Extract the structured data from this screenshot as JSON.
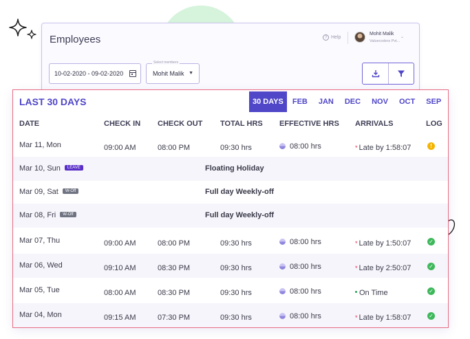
{
  "header": {
    "title": "Employees",
    "help_label": "Help",
    "user_name": "Mohit Malik",
    "user_org": "Valuecoders Pvt...",
    "date_range": "10-02-2020 - 09-02-2020",
    "select_members_legend": "Select members",
    "selected_member": "Mohit Malik"
  },
  "attendance": {
    "title": "LAST 30 DAYS",
    "periods": [
      "30 DAYS",
      "FEB",
      "JAN",
      "DEC",
      "NOV",
      "OCT",
      "SEP"
    ],
    "active_period": "30 DAYS",
    "columns": [
      "DATE",
      "CHECK IN",
      "CHECK OUT",
      "TOTAL HRS",
      "EFFECTIVE HRS",
      "ARRIVALS",
      "LOG"
    ],
    "rows": [
      {
        "date": "Mar 11, Mon",
        "check_in": "09:00 AM",
        "check_out": "08:00 PM",
        "total": "09:30 hrs",
        "effective": "08:00 hrs",
        "arrival": "Late by 1:58:07",
        "log": "warning-icon"
      },
      {
        "date": "Mar 10, Sun",
        "badge": "LEAVE",
        "note": "Floating Holiday"
      },
      {
        "date": "Mar 09, Sat",
        "badge": "W-Off",
        "note": "Full day Weekly-off"
      },
      {
        "date": "Mar 08, Fri",
        "badge": "W-Off",
        "note": "Full day Weekly-off"
      },
      {
        "date": "Mar 07, Thu",
        "check_in": "09:00 AM",
        "check_out": "08:00 PM",
        "total": "09:30 hrs",
        "effective": "08:00 hrs",
        "arrival": "Late by 1:50:07",
        "log": "check-icon"
      },
      {
        "date": "Mar 06, Wed",
        "check_in": "09:10 AM",
        "check_out": "08:30 PM",
        "total": "09:30 hrs",
        "effective": "08:00 hrs",
        "arrival": "Late by 2:50:07",
        "log": "check-icon"
      },
      {
        "date": "Mar 05, Tue",
        "check_in": "08:00 AM",
        "check_out": "08:30 PM",
        "total": "09:30 hrs",
        "effective": "08:00 hrs",
        "arrival": "On Time",
        "log": "check-icon"
      },
      {
        "date": "Mar 04, Mon",
        "check_in": "09:15 AM",
        "check_out": "07:30 PM",
        "total": "09:30 hrs",
        "effective": "08:00 hrs",
        "arrival": "Late by 1:58:07",
        "log": "check-icon"
      }
    ]
  },
  "colors": {
    "accent": "#4f46c8",
    "late": "#e2314f",
    "on_time": "#2aa05a",
    "warning": "#f4b400",
    "ok": "#3db85a"
  }
}
